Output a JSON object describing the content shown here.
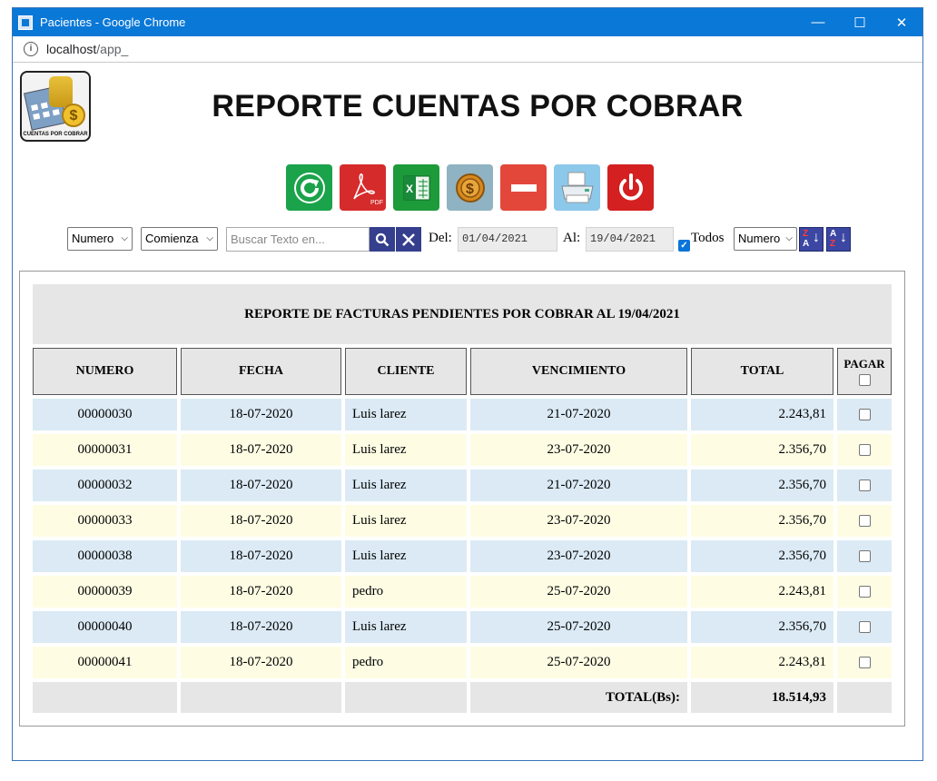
{
  "window": {
    "title": "Pacientes - Google Chrome",
    "minimize": "—",
    "maximize": "☐",
    "close": "✕"
  },
  "address": {
    "host": "localhost",
    "path": "/app_"
  },
  "logo": {
    "caption": "CUENTAS POR COBRAR",
    "coin_symbol": "$"
  },
  "page": {
    "title": "REPORTE CUENTAS POR COBRAR"
  },
  "toolbar": {
    "buttons": [
      {
        "name": "refresh",
        "icon": "refresh-icon",
        "color": "#1aa34a"
      },
      {
        "name": "pdf",
        "icon": "pdf-icon",
        "color": "#d62b2b",
        "label": "PDF"
      },
      {
        "name": "excel",
        "icon": "excel-icon",
        "color": "#1d9a3a"
      },
      {
        "name": "pay",
        "icon": "coin-icon",
        "color": "#8fb3c2",
        "label": "$"
      },
      {
        "name": "remove",
        "icon": "minus-icon",
        "color": "#e2473a"
      },
      {
        "name": "print",
        "icon": "printer-icon",
        "color": "#8cc8ea"
      },
      {
        "name": "exit",
        "icon": "power-icon",
        "color": "#d42020"
      }
    ]
  },
  "filters": {
    "field_select": "Numero",
    "mode_select": "Comienza",
    "search_placeholder": "Buscar Texto en...",
    "from_label": "Del:",
    "from_date": "01/04/2021",
    "to_label": "Al:",
    "to_date": "19/04/2021",
    "all_label": "Todos",
    "all_checked": true,
    "sort_select": "Numero",
    "sort_desc_top": "Z",
    "sort_desc_bottom": "A",
    "sort_asc_top": "A",
    "sort_asc_bottom": "Z",
    "sort_arrow": "↓"
  },
  "report": {
    "title": "REPORTE DE FACTURAS PENDIENTES POR COBRAR AL 19/04/2021",
    "columns": {
      "numero": "NUMERO",
      "fecha": "FECHA",
      "cliente": "CLIENTE",
      "vencimiento": "VENCIMIENTO",
      "total": "TOTAL",
      "pagar": "PAGAR"
    },
    "rows": [
      {
        "numero": "00000030",
        "fecha": "18-07-2020",
        "cliente": "Luis larez",
        "vencimiento": "21-07-2020",
        "total": "2.243,81"
      },
      {
        "numero": "00000031",
        "fecha": "18-07-2020",
        "cliente": "Luis larez",
        "vencimiento": "23-07-2020",
        "total": "2.356,70"
      },
      {
        "numero": "00000032",
        "fecha": "18-07-2020",
        "cliente": "Luis larez",
        "vencimiento": "21-07-2020",
        "total": "2.356,70"
      },
      {
        "numero": "00000033",
        "fecha": "18-07-2020",
        "cliente": "Luis larez",
        "vencimiento": "23-07-2020",
        "total": "2.356,70"
      },
      {
        "numero": "00000038",
        "fecha": "18-07-2020",
        "cliente": "Luis larez",
        "vencimiento": "23-07-2020",
        "total": "2.356,70"
      },
      {
        "numero": "00000039",
        "fecha": "18-07-2020",
        "cliente": "pedro",
        "vencimiento": "25-07-2020",
        "total": "2.243,81"
      },
      {
        "numero": "00000040",
        "fecha": "18-07-2020",
        "cliente": "Luis larez",
        "vencimiento": "25-07-2020",
        "total": "2.356,70"
      },
      {
        "numero": "00000041",
        "fecha": "18-07-2020",
        "cliente": "pedro",
        "vencimiento": "25-07-2020",
        "total": "2.243,81"
      }
    ],
    "total_label": "TOTAL(Bs):",
    "total_value": "18.514,93"
  }
}
